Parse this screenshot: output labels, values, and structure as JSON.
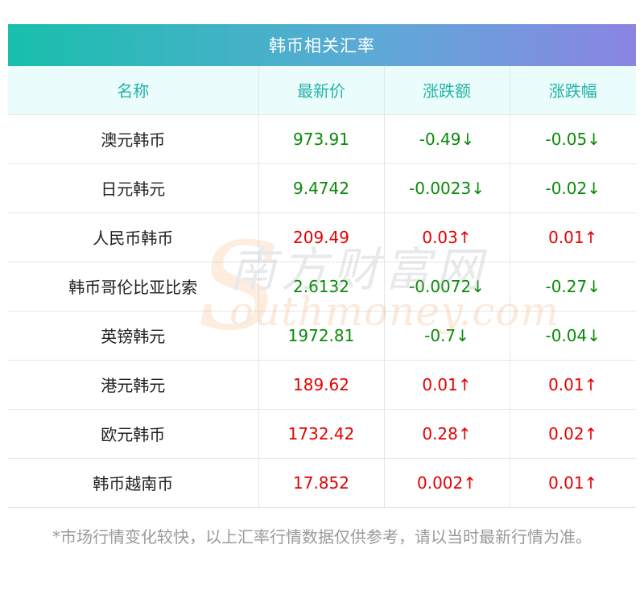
{
  "title": "韩币相关汇率",
  "headers": [
    "名称",
    "最新价",
    "涨跌额",
    "涨跌幅"
  ],
  "rows": [
    {
      "name": "澳元韩币",
      "price": "973.91",
      "change": "-0.49↓",
      "pct": "-0.05↓",
      "dir": "down"
    },
    {
      "name": "日元韩元",
      "price": "9.4742",
      "change": "-0.0023↓",
      "pct": "-0.02↓",
      "dir": "down"
    },
    {
      "name": "人民币韩币",
      "price": "209.49",
      "change": "0.03↑",
      "pct": "0.01↑",
      "dir": "up"
    },
    {
      "name": "韩币哥伦比亚比索",
      "price": "2.6132",
      "change": "-0.0072↓",
      "pct": "-0.27↓",
      "dir": "down"
    },
    {
      "name": "英镑韩元",
      "price": "1972.81",
      "change": "-0.7↓",
      "pct": "-0.04↓",
      "dir": "down"
    },
    {
      "name": "港元韩元",
      "price": "189.62",
      "change": "0.01↑",
      "pct": "0.01↑",
      "dir": "up"
    },
    {
      "name": "欧元韩币",
      "price": "1732.42",
      "change": "0.28↑",
      "pct": "0.02↑",
      "dir": "up"
    },
    {
      "name": "韩币越南币",
      "price": "17.852",
      "change": "0.002↑",
      "pct": "0.01↑",
      "dir": "up"
    }
  ],
  "watermark": {
    "cn": "南方财富网",
    "en": "outhmoney.com",
    "s": "S"
  },
  "note": "*市场行情变化较快，以上汇率行情数据仅供参考，请以当时最新行情为准。",
  "colors": {
    "up": "#e60000",
    "down": "#0a8a0a",
    "header_text": "#24b3a6",
    "header_bg": "#eafcfc"
  }
}
